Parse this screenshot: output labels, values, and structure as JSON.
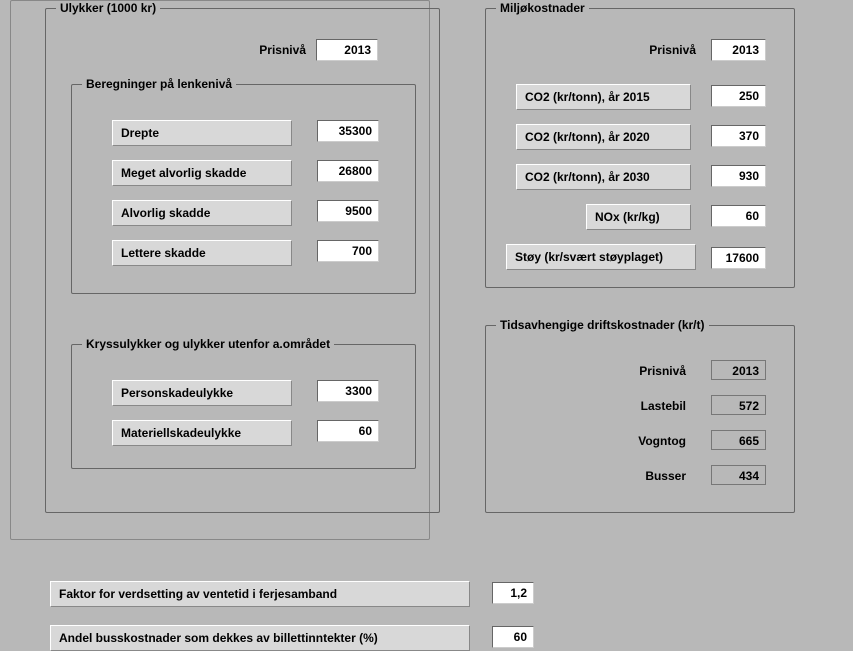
{
  "ulykker": {
    "title": "Ulykker (1000 kr)",
    "prisniva_label": "Prisnivå",
    "prisniva_value": "2013",
    "beregninger": {
      "title": "Beregninger på lenkenivå",
      "drepte_label": "Drepte",
      "drepte_value": "35300",
      "meget_label": "Meget alvorlig skadde",
      "meget_value": "26800",
      "alvorlig_label": "Alvorlig skadde",
      "alvorlig_value": "9500",
      "lettere_label": "Lettere skadde",
      "lettere_value": "700"
    },
    "kryss": {
      "title": "Kryssulykker og ulykker utenfor a.området",
      "person_label": "Personskadeulykke",
      "person_value": "3300",
      "materiell_label": "Materiellskadeulykke",
      "materiell_value": "60"
    }
  },
  "miljo": {
    "title": "Miljøkostnader",
    "prisniva_label": "Prisnivå",
    "prisniva_value": "2013",
    "co2_2015_label": "CO2 (kr/tonn), år 2015",
    "co2_2015_value": "250",
    "co2_2020_label": "CO2 (kr/tonn), år 2020",
    "co2_2020_value": "370",
    "co2_2030_label": "CO2 (kr/tonn), år 2030",
    "co2_2030_value": "930",
    "nox_label": "NOx (kr/kg)",
    "nox_value": "60",
    "stoy_label": "Støy (kr/svært støyplaget)",
    "stoy_value": "17600"
  },
  "tids": {
    "title": "Tidsavhengige driftskostnader (kr/t)",
    "prisniva_label": "Prisnivå",
    "prisniva_value": "2013",
    "lastebil_label": "Lastebil",
    "lastebil_value": "572",
    "vogntog_label": "Vogntog",
    "vogntog_value": "665",
    "busser_label": "Busser",
    "busser_value": "434"
  },
  "bottom": {
    "faktor_label": "Faktor for verdsetting av ventetid i ferjesamband",
    "faktor_value": "1,2",
    "andel_label": "Andel busskostnader som dekkes av billettinntekter (%)",
    "andel_value": "60"
  }
}
